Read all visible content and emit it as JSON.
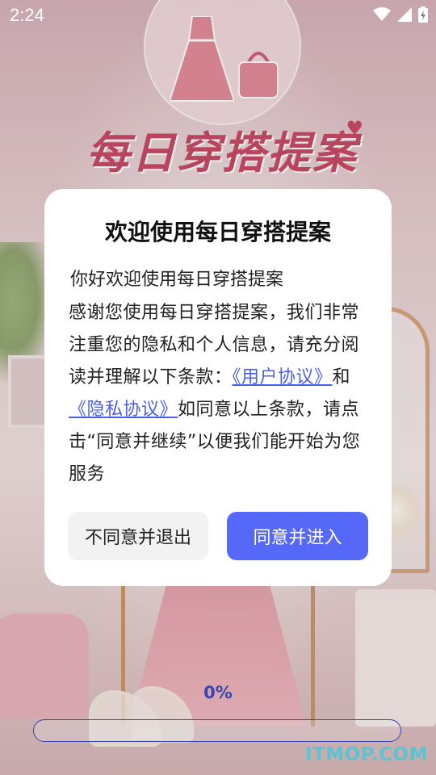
{
  "status_bar": {
    "time": "2:24",
    "icons": [
      "wifi-icon",
      "cellular-signal-icon",
      "battery-charging-icon"
    ]
  },
  "logo": {
    "title": "每日穿搭提案"
  },
  "dialog": {
    "title": "欢迎使用每日穿搭提案",
    "greeting": "你好欢迎使用每日穿搭提案",
    "body_intro": "感谢您使用每日穿搭提案，我们非常注重您的隐私和个人信息，请充分阅读并理解以下条款：",
    "user_agreement_link": "《用户协议》",
    "and_text": "和",
    "privacy_policy_link": "《隐私协议》",
    "body_outro": "如同意以上条款，请点击“同意并继续”以便我们能开始为您服务",
    "decline_button": "不同意并退出",
    "accept_button": "同意并进入"
  },
  "progress": {
    "label": "0%",
    "value": 0
  },
  "watermark": "ITMOP.COM",
  "colors": {
    "accent": "#5668f7",
    "link": "#4a60ea",
    "logo": "#c84a66",
    "progress_text": "#3d4bbd"
  }
}
